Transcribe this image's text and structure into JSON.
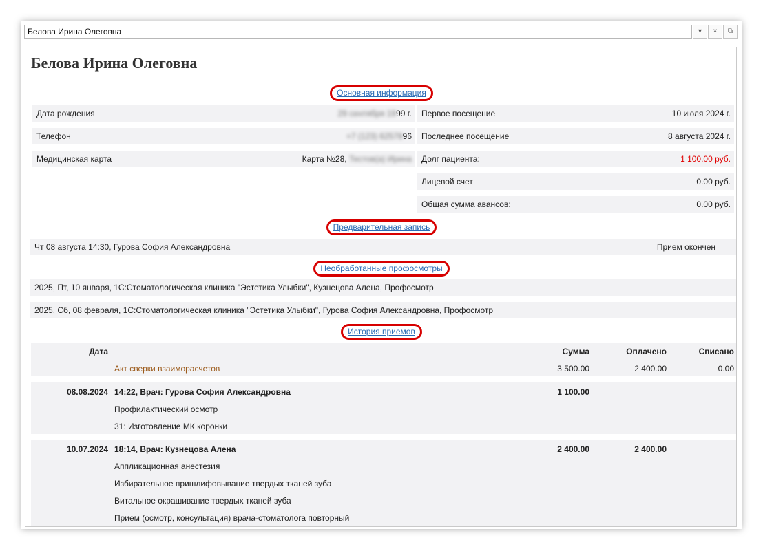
{
  "window": {
    "title": "Белова Ирина Олеговна",
    "buttons": [
      "▾",
      "×",
      "⧉"
    ]
  },
  "patient": {
    "name": "Белова Ирина Олеговна"
  },
  "sections": {
    "main_info": "Основная информация",
    "appointment": "Предварительная запись",
    "checkups": "Необработанные профосмотры",
    "history": "История приемов"
  },
  "info_left": [
    {
      "label": "Дата рождения",
      "value_hidden": "29 сентября 19",
      "value_visible": "99 г."
    },
    {
      "label": "Телефон",
      "value_hidden": "+7 (123) 62578",
      "value_visible": "96"
    },
    {
      "label": "Медицинская карта",
      "value_visible": "Карта №28, ",
      "value_hidden": "Тестов(а) Ирина"
    }
  ],
  "info_right": [
    {
      "label": "Первое посещение",
      "value": "10 июля 2024 г."
    },
    {
      "label": "Последнее посещение",
      "value": "8 августа 2024 г."
    },
    {
      "label": "Долг пациента:",
      "value": "1 100.00 руб.",
      "color": "#e00000"
    },
    {
      "label": "Лицевой счет",
      "value": "0.00 руб."
    },
    {
      "label": "Общая сумма авансов:",
      "value": "0.00 руб."
    }
  ],
  "appointment": {
    "text": "Чт 08 августа 14:30, Гурова София Александровна",
    "status": "Прием окончен"
  },
  "checkups": [
    "2025, Пт, 10 января, 1С:Стоматологическая клиника \"Эстетика Улыбки\", Кузнецова Алена, Профосмотр",
    "2025, Сб, 08 февраля, 1С:Стоматологическая клиника \"Эстетика Улыбки\", Гурова София Александровна, Профосмотр"
  ],
  "history": {
    "headers": {
      "date": "Дата",
      "sum": "Сумма",
      "paid": "Оплачено",
      "written_off": "Списано"
    },
    "reconciliation": {
      "label": "Акт сверки взаиморасчетов",
      "sum": "3 500.00",
      "paid": "2 400.00",
      "written_off": "0.00"
    },
    "visits": [
      {
        "date": "08.08.2024",
        "title": "14:22, Врач: Гурова София Александровна",
        "sum": "1 100.00",
        "paid": "",
        "items": [
          "Профилактический осмотр",
          "31: Изготовление МК коронки"
        ]
      },
      {
        "date": "10.07.2024",
        "title": "18:14, Врач: Кузнецова Алена",
        "sum": "2 400.00",
        "paid": "2 400.00",
        "items": [
          "Аппликационная анестезия",
          "Избирательное пришлифовывание твердых тканей зуба",
          "Витальное окрашивание твердых тканей зуба",
          "Прием (осмотр, консультация) врача-стоматолога повторный"
        ]
      }
    ]
  }
}
